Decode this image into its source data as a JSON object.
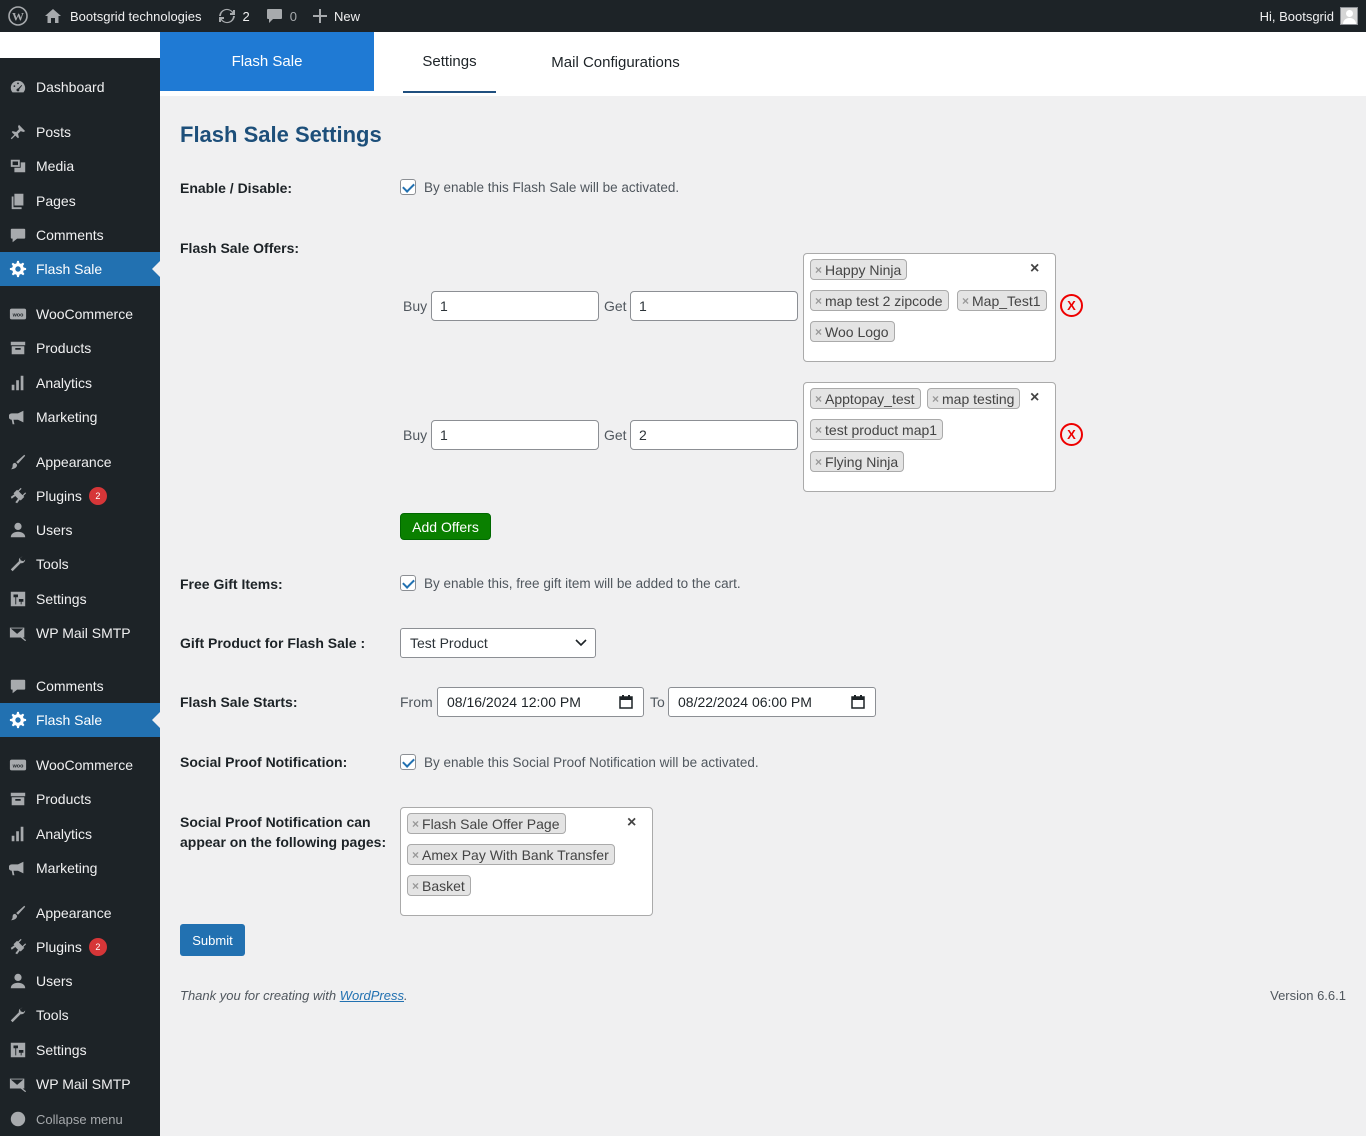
{
  "admin_bar": {
    "site_name": "Bootsgrid technologies",
    "updates_count": "2",
    "comments_count": "0",
    "new_label": "New",
    "greeting": "Hi, Bootsgrid"
  },
  "sidebar": {
    "items": [
      {
        "label": "Dashboard",
        "icon": "dashboard-icon"
      },
      {
        "label": "Posts",
        "icon": "pin-icon"
      },
      {
        "label": "Media",
        "icon": "media-icon"
      },
      {
        "label": "Pages",
        "icon": "pages-icon"
      },
      {
        "label": "Comments",
        "icon": "comment-icon"
      },
      {
        "label": "Flash Sale",
        "icon": "gear-icon",
        "active": true
      },
      {
        "label": "WooCommerce",
        "icon": "woo-icon"
      },
      {
        "label": "Products",
        "icon": "archive-icon"
      },
      {
        "label": "Analytics",
        "icon": "chart-bar-icon"
      },
      {
        "label": "Marketing",
        "icon": "megaphone-icon"
      },
      {
        "label": "Appearance",
        "icon": "brush-icon"
      },
      {
        "label": "Plugins",
        "icon": "plug-icon",
        "badge": "2"
      },
      {
        "label": "Users",
        "icon": "user-icon"
      },
      {
        "label": "Tools",
        "icon": "wrench-icon"
      },
      {
        "label": "Settings",
        "icon": "settings-icon"
      },
      {
        "label": "WP Mail SMTP",
        "icon": "mail-icon"
      }
    ],
    "items_repeat": [
      {
        "label": "Comments"
      },
      {
        "label": "Flash Sale"
      },
      {
        "label": "WooCommerce"
      },
      {
        "label": "Products"
      },
      {
        "label": "Analytics"
      },
      {
        "label": "Marketing"
      },
      {
        "label": "Appearance"
      },
      {
        "label": "Plugins",
        "badge": "2"
      },
      {
        "label": "Users"
      },
      {
        "label": "Tools"
      },
      {
        "label": "Settings"
      },
      {
        "label": "WP Mail SMTP"
      }
    ],
    "collapse_label": "Collapse menu"
  },
  "tabs": {
    "brand": "Flash Sale",
    "settings": "Settings",
    "mail": "Mail Configurations"
  },
  "page": {
    "title": "Flash Sale Settings",
    "enable_label": "Enable / Disable:",
    "enable_text": "By enable this Flash Sale will be activated.",
    "offers_label": "Flash Sale Offers:",
    "buy_label": "Buy",
    "get_label": "Get",
    "offers": [
      {
        "buy": "1",
        "get": "1",
        "products": [
          "Happy Ninja",
          "map test 2 zipcode",
          "Map_Test1",
          "Woo Logo"
        ]
      },
      {
        "buy": "1",
        "get": "2",
        "products": [
          "Apptopay_test",
          "map testing",
          "test product map1",
          "Flying Ninja"
        ]
      }
    ],
    "tag_remove": "×",
    "clear_all": "×",
    "remove_offer": "X",
    "add_offers": "Add Offers",
    "free_gift_label": "Free Gift Items:",
    "free_gift_text": "By enable this, free gift item will be added to the cart.",
    "gift_product_label": "Gift Product for Flash Sale :",
    "gift_product_value": "Test Product",
    "starts_label": "Flash Sale Starts:",
    "from_label": "From",
    "from_value": "08/16/2024 12:00 PM",
    "to_label": "To",
    "to_value": "08/22/2024 06:00 PM",
    "social_label": "Social Proof Notification:",
    "social_text": "By enable this Social Proof Notification will be activated.",
    "social_pages_label_1": "Social Proof Notification can",
    "social_pages_label_2": "appear on the following pages:",
    "social_pages": [
      "Flash Sale Offer Page",
      "Amex Pay With Bank Transfer",
      "Basket"
    ],
    "submit": "Submit"
  },
  "footer": {
    "thanks_prefix": "Thank you for creating with ",
    "thanks_link": "WordPress",
    "thanks_suffix": ".",
    "version": "Version 6.6.1"
  },
  "colors": {
    "admin_bar": "#1d2327",
    "active_menu": "#2271b1",
    "brand_tab": "#1f7ad4",
    "add_offers": "#0a8000",
    "remove_offer": "#ee0000"
  }
}
